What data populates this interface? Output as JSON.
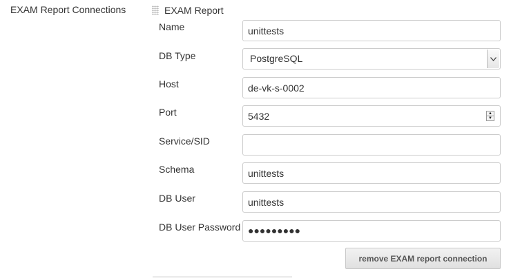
{
  "section": {
    "label": "EXAM Report Connections"
  },
  "group": {
    "title": "EXAM Report"
  },
  "fields": {
    "name": {
      "label": "Name",
      "value": "unittests"
    },
    "db_type": {
      "label": "DB Type",
      "value": "PostgreSQL"
    },
    "host": {
      "label": "Host",
      "value": "de-vk-s-0002"
    },
    "port": {
      "label": "Port",
      "value": "5432"
    },
    "service_sid": {
      "label": "Service/SID",
      "value": ""
    },
    "schema": {
      "label": "Schema",
      "value": "unittests"
    },
    "db_user": {
      "label": "DB User",
      "value": "unittests"
    },
    "db_user_password": {
      "label": "DB User Password",
      "value": "●●●●●●●●●"
    }
  },
  "actions": {
    "remove_label": "remove EXAM report connection"
  },
  "icons": {
    "drag_handle": "drag-handle-icon",
    "select_arrow": "chevron-down-icon",
    "spinner_up": "spinner-up-icon",
    "spinner_down": "spinner-down-icon"
  }
}
